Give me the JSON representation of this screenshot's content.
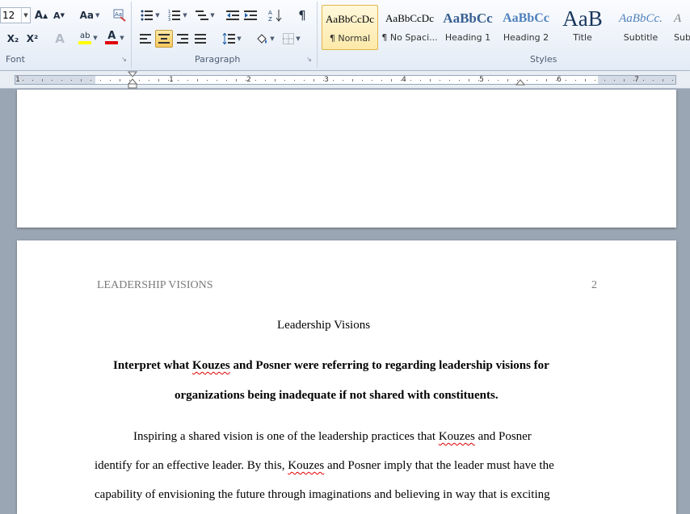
{
  "ribbon": {
    "font_group": {
      "label": "Font",
      "font_size": "12",
      "grow_label": "A",
      "shrink_label": "A",
      "change_case_label": "Aa",
      "subscript_label": "X₂",
      "superscript_label": "X²",
      "highlight_label": "ab",
      "font_color_label": "A",
      "text_effects_label": "A",
      "highlight_color": "#ffff00",
      "font_color": "#e00000"
    },
    "paragraph_group": {
      "label": "Paragraph",
      "pilcrow": "¶"
    },
    "styles_group": {
      "label": "Styles",
      "items": [
        {
          "preview": "AaBbCcDc",
          "name": "¶ Normal"
        },
        {
          "preview": "AaBbCcDc",
          "name": "¶ No Spaci..."
        },
        {
          "preview": "AaBbCc",
          "name": "Heading 1"
        },
        {
          "preview": "AaBbCc",
          "name": "Heading 2"
        },
        {
          "preview": "AaB",
          "name": "Title"
        },
        {
          "preview": "AaBbCc.",
          "name": "Subtitle"
        },
        {
          "preview": "A",
          "name": "Sub"
        }
      ]
    }
  },
  "ruler": {
    "numbers": [
      "1",
      "1",
      "2",
      "3",
      "4",
      "5",
      "6",
      "7"
    ]
  },
  "document": {
    "page2": {
      "running_head": "LEADERSHIP VISIONS",
      "page_number": "2",
      "title": "Leadership Visions",
      "question_line1": {
        "a": "Interpret what ",
        "b": "Kouzes",
        "c": " and Posner were referring to regarding leadership visions for"
      },
      "question_line2": "organizations being inadequate if not shared with constituents.",
      "body_line1": {
        "a": "Inspiring a shared vision is one of the leadership practices that ",
        "b": "Kouzes",
        "c": " and Posner"
      },
      "body_line2": {
        "a": "identify for an effective leader. By this, ",
        "b": "Kouzes",
        "c": " and Posner imply that the leader must have the"
      },
      "body_line3": "capability of envisioning the future through imaginations and believing in way that is exciting"
    }
  }
}
